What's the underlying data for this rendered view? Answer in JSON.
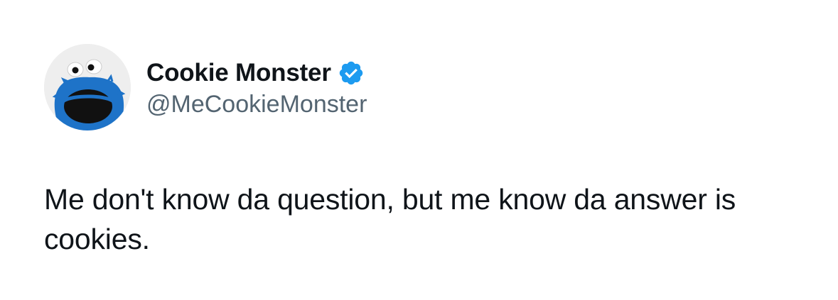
{
  "tweet": {
    "author": {
      "display_name": "Cookie Monster",
      "handle": "@MeCookieMonster",
      "verified": true,
      "avatar_icon": "cookie-monster-avatar",
      "verified_icon": "verified-badge-icon"
    },
    "text": "Me don't know da question, but me know da answer is cookies."
  },
  "colors": {
    "name_text": "#0f1419",
    "handle_text": "#536471",
    "verified_blue": "#1d9bf0",
    "avatar_blue": "#1e73c8",
    "avatar_bg": "#eeeeee"
  }
}
